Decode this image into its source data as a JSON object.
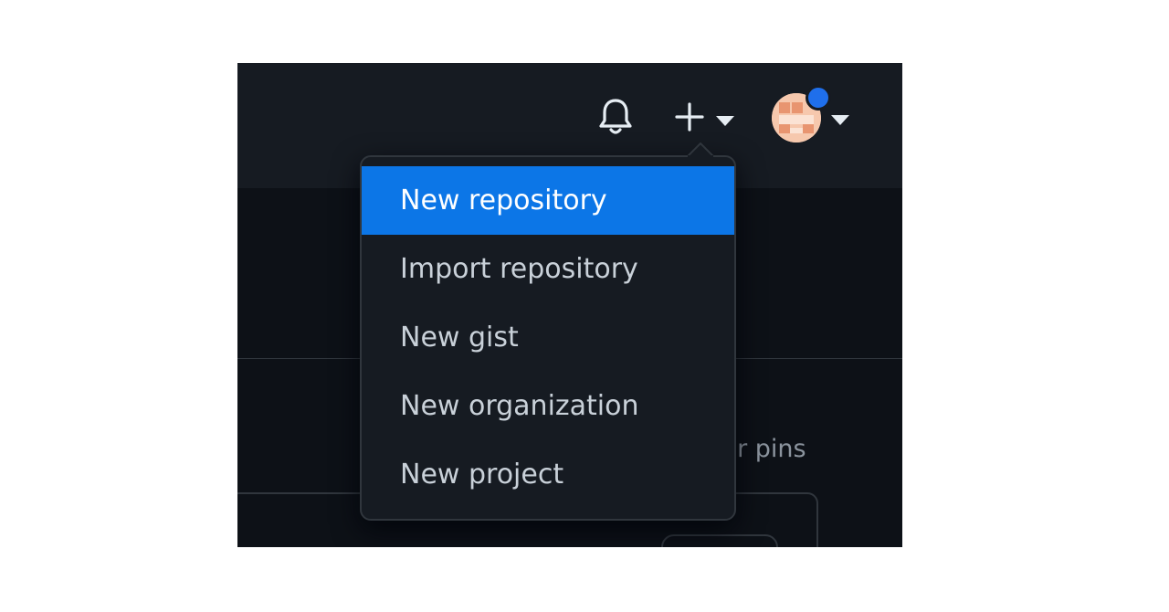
{
  "header": {
    "notifications_icon": "bell-icon",
    "create_icon": "plus-icon",
    "create_caret_icon": "caret-down-icon",
    "avatar_caret_icon": "caret-down-icon"
  },
  "create_menu": {
    "items": [
      {
        "label": "New repository",
        "highlighted": true
      },
      {
        "label": "Import repository",
        "highlighted": false
      },
      {
        "label": "New gist",
        "highlighted": false
      },
      {
        "label": "New organization",
        "highlighted": false
      },
      {
        "label": "New project",
        "highlighted": false
      }
    ]
  },
  "background": {
    "pins_text": "ur pins"
  },
  "colors": {
    "header_bg": "#161b22",
    "page_bg": "#0d1117",
    "menu_bg": "#161b22",
    "menu_border": "#30363d",
    "highlight": "#0c76e7",
    "text": "#c9d1d9",
    "muted_text": "#8b949e",
    "icon": "#e6edf3",
    "notification_dot": "#1f6feb"
  }
}
